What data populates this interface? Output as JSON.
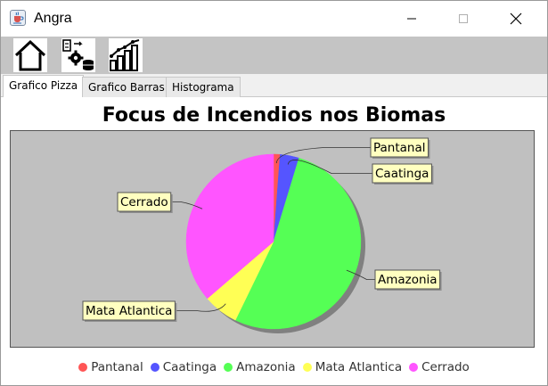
{
  "window": {
    "title": "Angra",
    "app_icon": "java-coffee-cup-icon"
  },
  "toolbar": {
    "buttons": [
      {
        "icon": "home-icon"
      },
      {
        "icon": "database-settings-icon"
      },
      {
        "icon": "bar-chart-growth-icon"
      }
    ]
  },
  "tabs": [
    {
      "label": "Grafico Pizza",
      "active": true
    },
    {
      "label": "Grafico Barras",
      "active": false
    },
    {
      "label": "Histograma",
      "active": false
    }
  ],
  "chart_data": {
    "type": "pie",
    "title": "Focus de Incendios nos Biomas",
    "start": "12 o'clock",
    "direction": "clockwise",
    "slices": [
      {
        "label": "Pantanal",
        "value": 1.2,
        "color": "#FF5555"
      },
      {
        "label": "Caatinga",
        "value": 3.5,
        "color": "#5555FF"
      },
      {
        "label": "Amazonia",
        "value": 52.5,
        "color": "#55FF55"
      },
      {
        "label": "Mata Atlantica",
        "value": 6.5,
        "color": "#FFFF55"
      },
      {
        "label": "Cerrado",
        "value": 36.3,
        "color": "#FF55FF"
      }
    ],
    "plot_background": "#C0C0C0",
    "label_box_background": "#FFFFC0",
    "legend_position": "bottom"
  }
}
